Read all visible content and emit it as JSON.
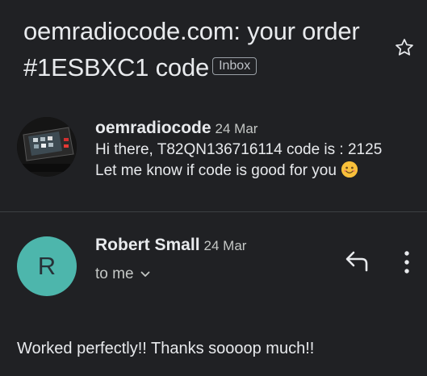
{
  "subject": {
    "title": "oemradiocode.com: your order #1ESBXC1 code",
    "label": "Inbox"
  },
  "messages": [
    {
      "sender": "oemradiocode",
      "date": "24 Mar",
      "snippet_line1": "Hi there, T82QN136716114 code is : 2125",
      "snippet_line2": "Let me know if code is good for you"
    },
    {
      "avatar_letter": "R",
      "sender": "Robert Small",
      "date": "24 Mar",
      "recipient": "to me",
      "body": "Worked perfectly!!  Thanks soooop much!!"
    }
  ],
  "colors": {
    "background": "#202124",
    "avatar": "#4db6ac",
    "divider": "#3c4043",
    "emoji": "#f8c03a"
  },
  "icons": [
    "star-icon",
    "smiley-emoji-icon",
    "chevron-down-icon",
    "reply-icon",
    "more-vert-icon"
  ]
}
